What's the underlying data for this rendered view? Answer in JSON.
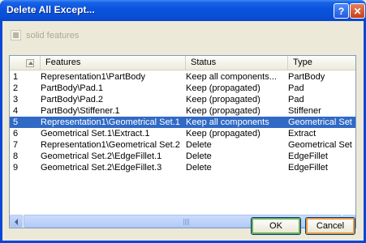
{
  "window": {
    "title": "Delete All Except...",
    "help_label": "?",
    "close_label": "✕"
  },
  "options": {
    "solid_features_label": "solid features",
    "solid_features_checked": true,
    "solid_features_enabled": false
  },
  "table": {
    "columns": [
      "Features",
      "Status",
      "Type"
    ],
    "rows": [
      {
        "num": "1",
        "feature": "Representation1\\PartBody",
        "status": "Keep all components...",
        "type": "PartBody",
        "selected": false
      },
      {
        "num": "2",
        "feature": "PartBody\\Pad.1",
        "status": "Keep (propagated)",
        "type": "Pad",
        "selected": false
      },
      {
        "num": "3",
        "feature": "PartBody\\Pad.2",
        "status": "Keep (propagated)",
        "type": "Pad",
        "selected": false
      },
      {
        "num": "4",
        "feature": "PartBody\\Stiffener.1",
        "status": "Keep (propagated)",
        "type": "Stiffener",
        "selected": false
      },
      {
        "num": "5",
        "feature": "Representation1\\Geometrical Set.1",
        "status": "Keep all components",
        "type": "Geometrical Set",
        "selected": true
      },
      {
        "num": "6",
        "feature": "Geometrical Set.1\\Extract.1",
        "status": "Keep (propagated)",
        "type": "Extract",
        "selected": false
      },
      {
        "num": "7",
        "feature": "Representation1\\Geometrical Set.2",
        "status": "Delete",
        "type": "Geometrical Set",
        "selected": false
      },
      {
        "num": "8",
        "feature": "Geometrical Set.2\\EdgeFillet.1",
        "status": "Delete",
        "type": "EdgeFillet",
        "selected": false
      },
      {
        "num": "9",
        "feature": "Geometrical Set.2\\EdgeFillet.3",
        "status": "Delete",
        "type": "EdgeFillet",
        "selected": false
      }
    ]
  },
  "buttons": {
    "ok_label": "OK",
    "cancel_label": "Cancel"
  },
  "colors": {
    "title_bar": "#0a4fd6",
    "selection": "#316ac5",
    "dialog_bg": "#ece9d8"
  }
}
